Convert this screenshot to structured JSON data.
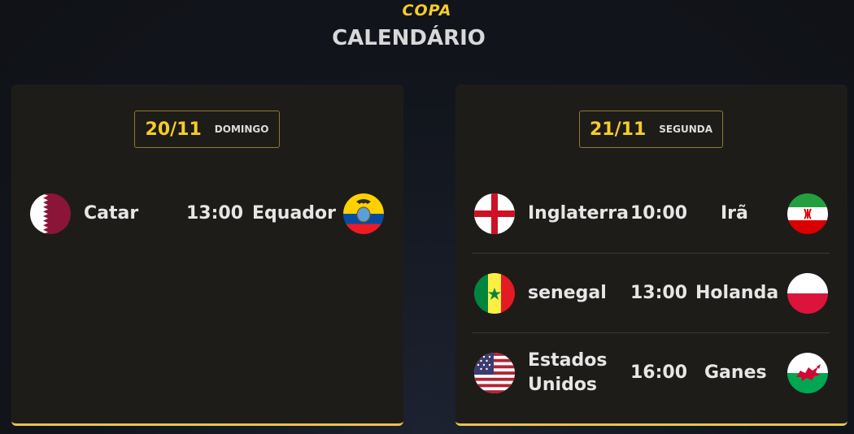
{
  "header": {
    "brand": "COPA",
    "title": "CALENDÁRIO"
  },
  "colors": {
    "accent": "#f5cc2a",
    "card_bg": "#1e1c19",
    "border_gold": "#e9c54a"
  },
  "days": [
    {
      "date": "20/11",
      "weekday": "DOMINGO",
      "matches": [
        {
          "home": "Catar",
          "home_flag": "qatar-flag-icon",
          "time": "13:00",
          "away": "Equador",
          "away_flag": "ecuador-flag-icon"
        }
      ]
    },
    {
      "date": "21/11",
      "weekday": "SEGUNDA",
      "matches": [
        {
          "home": "Inglaterra",
          "home_flag": "england-flag-icon",
          "time": "10:00",
          "away": "Irã",
          "away_flag": "iran-flag-icon"
        },
        {
          "home": "senegal",
          "home_flag": "senegal-flag-icon",
          "time": "13:00",
          "away": "Holanda",
          "away_flag": "poland-flag-icon"
        },
        {
          "home_line1": "Estados",
          "home_line2": "Unidos",
          "home_flag": "usa-flag-icon",
          "time": "16:00",
          "away": "Ganes",
          "away_flag": "wales-flag-icon"
        }
      ]
    }
  ]
}
